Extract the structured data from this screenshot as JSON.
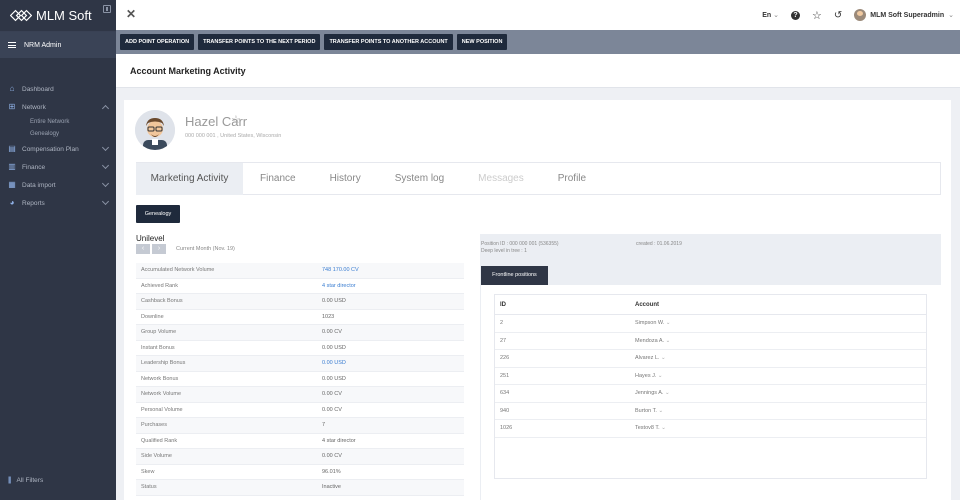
{
  "app": {
    "brand": "MLM Soft",
    "role": "NRM Admin"
  },
  "sidebar": {
    "items": [
      {
        "label": "Dashboard",
        "icon": "home-icon"
      },
      {
        "label": "Network",
        "icon": "network-icon",
        "expanded": true,
        "children": [
          "Entire Network",
          "Genealogy"
        ]
      },
      {
        "label": "Compensation Plan",
        "icon": "plan-icon"
      },
      {
        "label": "Finance",
        "icon": "finance-icon"
      },
      {
        "label": "Data import",
        "icon": "import-icon"
      },
      {
        "label": "Reports",
        "icon": "reports-icon"
      }
    ],
    "footer": "All Filters"
  },
  "topbar": {
    "language": "En",
    "user_name": "MLM Soft Superadmin"
  },
  "actions": [
    "ADD POINT OPERATION",
    "TRANSFER POINTS TO THE NEXT PERIOD",
    "TRANSFER POINTS TO ANOTHER ACCOUNT",
    "NEW POSITION"
  ],
  "page": {
    "title": "Account Marketing Activity"
  },
  "profile": {
    "name": "Hazel Carr",
    "info": "000 000 001 , United States, Wisconsin"
  },
  "tabs": [
    {
      "label": "Marketing Activity",
      "state": "active"
    },
    {
      "label": "Finance",
      "state": "normal"
    },
    {
      "label": "History",
      "state": "normal"
    },
    {
      "label": "System log",
      "state": "normal"
    },
    {
      "label": "Messages",
      "state": "disabled"
    },
    {
      "label": "Profile",
      "state": "normal"
    }
  ],
  "genealogy_button": "Genealogy",
  "unilevel": {
    "title": "Unilevel",
    "period": "Current Month (Nov. 19)"
  },
  "stats": [
    {
      "key": "Accumulated Network Volume",
      "value": "748 170.00 CV",
      "link": true
    },
    {
      "key": "Achieved Rank",
      "value": "4 star director",
      "link": true
    },
    {
      "key": "Cashback Bonus",
      "value": "0.00 USD",
      "link": false
    },
    {
      "key": "Downline",
      "value": "1023",
      "link": false
    },
    {
      "key": "Group Volume",
      "value": "0.00 CV",
      "link": false
    },
    {
      "key": "Instant Bonus",
      "value": "0.00 USD",
      "link": false
    },
    {
      "key": "Leadership Bonus",
      "value": "0.00 USD",
      "link": true
    },
    {
      "key": "Network Bonus",
      "value": "0.00 USD",
      "link": false
    },
    {
      "key": "Network Volume",
      "value": "0.00 CV",
      "link": false
    },
    {
      "key": "Personal Volume",
      "value": "0.00 CV",
      "link": false
    },
    {
      "key": "Purchases",
      "value": "7",
      "link": false
    },
    {
      "key": "Qualified Rank",
      "value": "4 star director",
      "link": false
    },
    {
      "key": "Side Volume",
      "value": "0.00 CV",
      "link": false
    },
    {
      "key": "Skew",
      "value": "96.01%",
      "link": false
    },
    {
      "key": "Status",
      "value": "Inactive",
      "link": false
    }
  ],
  "position": {
    "id_line": "Position ID : 000 000 001 (536355)",
    "level_line": "Deep level in tree : 1",
    "created": "created : 01.06.2019",
    "tab": "Frontline positions",
    "columns": [
      "ID",
      "Account"
    ],
    "rows": [
      {
        "id": "2",
        "account": "Simpson W."
      },
      {
        "id": "27",
        "account": "Mendoza A."
      },
      {
        "id": "226",
        "account": "Alvarez L."
      },
      {
        "id": "251",
        "account": "Hayes J."
      },
      {
        "id": "634",
        "account": "Jennings A."
      },
      {
        "id": "940",
        "account": "Burton T."
      },
      {
        "id": "1026",
        "account": "Testov8 T."
      }
    ]
  }
}
